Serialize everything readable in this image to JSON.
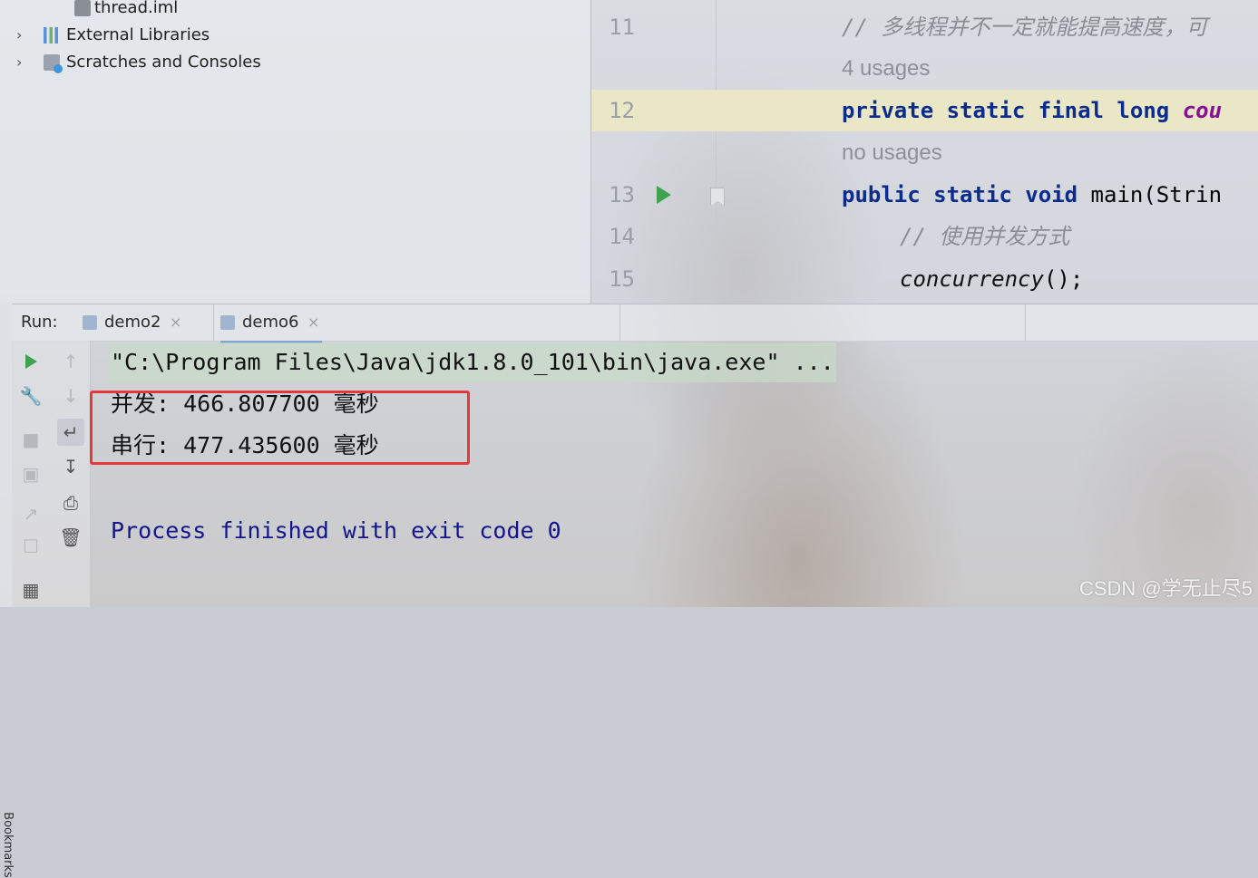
{
  "project_tree": {
    "items": [
      {
        "label": "thread.iml",
        "icon": "file-icon",
        "expandable": false
      },
      {
        "label": "External Libraries",
        "icon": "libraries-icon",
        "expandable": true
      },
      {
        "label": "Scratches and Consoles",
        "icon": "scratches-icon",
        "expandable": true
      }
    ]
  },
  "editor": {
    "lines": [
      {
        "num": "11",
        "comment": "// 多线程并不一定就能提高速度，可"
      },
      {
        "hint": "4 usages"
      },
      {
        "num": "12",
        "kw": "private static final long",
        "field": "cou"
      },
      {
        "hint": "no usages"
      },
      {
        "num": "13",
        "kw": "public static void",
        "rest": "main(Strin"
      },
      {
        "num": "14",
        "comment": "// 使用并发方式"
      },
      {
        "num": "15",
        "call": "concurrency",
        "rest": "();"
      }
    ]
  },
  "run_panel": {
    "label": "Run:",
    "tabs": [
      {
        "label": "demo2",
        "close": "×"
      },
      {
        "label": "demo6",
        "close": "×"
      }
    ],
    "side_label": "Bookmarks",
    "console": {
      "command": "\"C:\\Program Files\\Java\\jdk1.8.0_101\\bin\\java.exe\" ...",
      "line1": "并发: 466.807700 毫秒",
      "line2": "串行: 477.435600 毫秒",
      "exit": "Process finished with exit code 0"
    }
  },
  "watermark": "CSDN @学无止尽5",
  "colors": {
    "keyword": "#0b2c8c",
    "field": "#871094",
    "highlight_box": "#e63838",
    "exit_text": "#14148c",
    "run_green": "#3ea24e"
  }
}
